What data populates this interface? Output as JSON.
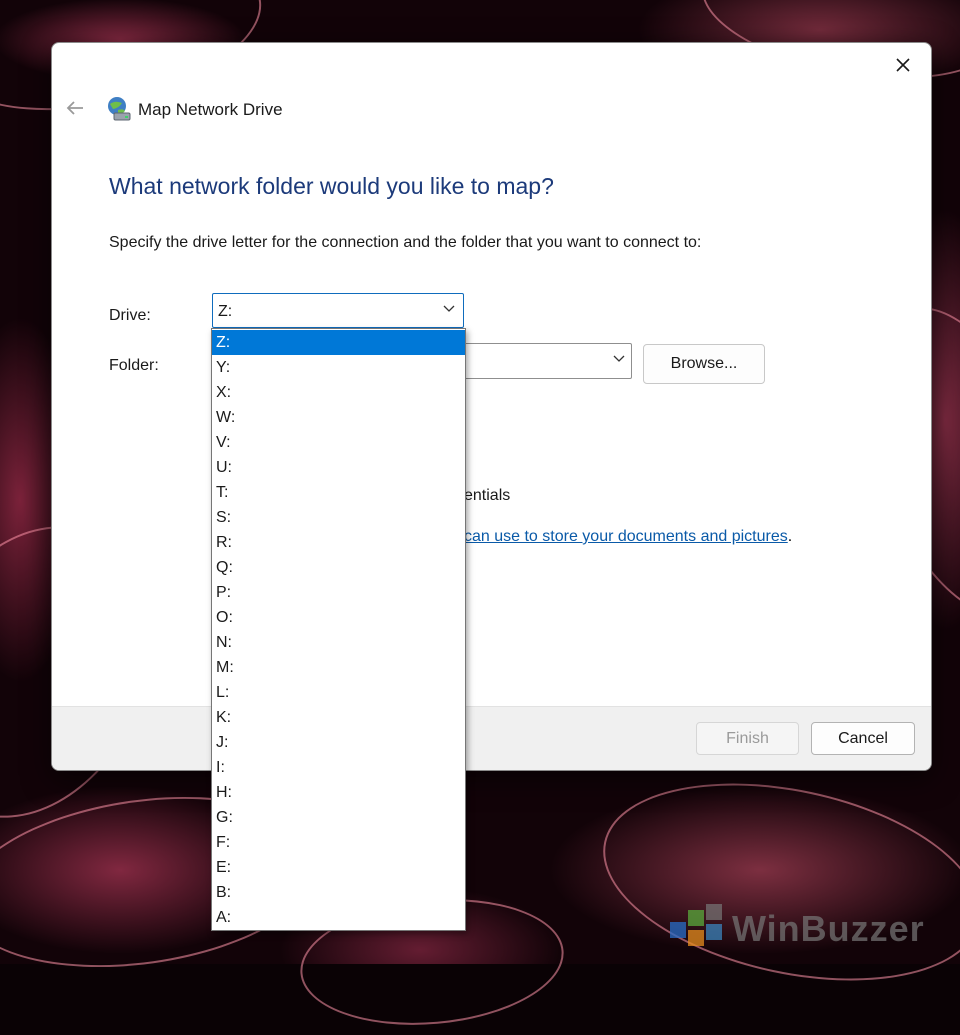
{
  "dialog": {
    "title": "Map Network Drive",
    "heading": "What network folder would you like to map?",
    "instructions": "Specify the drive letter for the connection and the folder that you want to connect to:",
    "drive_label": "Drive:",
    "drive_value": "Z:",
    "folder_label": "Folder:",
    "browse_label": "Browse...",
    "credentials_fragment": "entials",
    "link_fragment": "can use to store your documents and pictures",
    "link_suffix": ".",
    "finish_label": "Finish",
    "cancel_label": "Cancel"
  },
  "drive_options": [
    "Z:",
    "Y:",
    "X:",
    "W:",
    "V:",
    "U:",
    "T:",
    "S:",
    "R:",
    "Q:",
    "P:",
    "O:",
    "N:",
    "M:",
    "L:",
    "K:",
    "J:",
    "I:",
    "H:",
    "G:",
    "F:",
    "E:",
    "B:",
    "A:"
  ],
  "selected_option": "Z:",
  "icons": {
    "close": "close-icon",
    "back": "back-arrow-icon",
    "app": "network-drive-icon",
    "chevron": "chevron-down-icon"
  },
  "colors": {
    "heading": "#1c3a7a",
    "selection": "#0078d7",
    "link": "#0a5aa8"
  },
  "watermark": {
    "text": "WinBuzzer"
  }
}
